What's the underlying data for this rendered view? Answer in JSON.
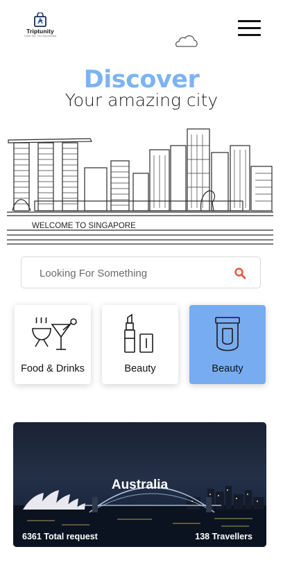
{
  "brand": {
    "name": "Triptunity",
    "tagline": "Travel Tips, Trip Opportunities"
  },
  "hero": {
    "title": "Discover",
    "subtitle": "Your amazing city",
    "skyline_caption": "WELCOME TO SINGAPORE"
  },
  "search": {
    "placeholder": "Looking For Something",
    "value": ""
  },
  "categories": [
    {
      "label": "Food & Drinks",
      "icon": "food-drinks-icon",
      "active": false
    },
    {
      "label": "Beauty",
      "icon": "lipstick-icon",
      "active": false
    },
    {
      "label": "Beauty",
      "icon": "cream-tube-icon",
      "active": true
    }
  ],
  "featured": {
    "city": "Australia",
    "total_requests": "6361 Total request",
    "travellers": "138 Travellers"
  },
  "colors": {
    "accent": "#77acf0",
    "title_blue": "#7cb3f2",
    "search_icon": "#e5533c"
  }
}
